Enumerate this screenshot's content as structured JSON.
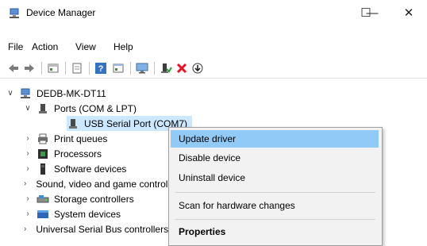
{
  "window": {
    "title": "Device Manager",
    "minimize": "—",
    "maximize": "☐",
    "close": "✕"
  },
  "menu": [
    "File",
    "Action",
    "View",
    "Help"
  ],
  "toolbar_icons": [
    "back-icon",
    "forward-icon",
    "properties-grid-icon",
    "show-hidden-icon",
    "help-icon",
    "view-icon",
    "monitor-scan-icon",
    "enable-device-icon",
    "uninstall-icon",
    "update-icon"
  ],
  "tree": {
    "computer": "DEDB-MK-DT11",
    "ports": "Ports (COM & LPT)",
    "usb_serial": "USB Serial Port (COM7)",
    "items": [
      "Print queues",
      "Processors",
      "Software devices",
      "Sound, video and game controllers",
      "Storage controllers",
      "System devices",
      "Universal Serial Bus controllers"
    ]
  },
  "context_menu": {
    "update": "Update driver",
    "disable": "Disable device",
    "uninstall": "Uninstall device",
    "scan": "Scan for hardware changes",
    "properties": "Properties"
  },
  "colors": {
    "selection": "#cce8ff",
    "menu_highlight": "#91c9f7",
    "delete_red": "#e81123"
  }
}
